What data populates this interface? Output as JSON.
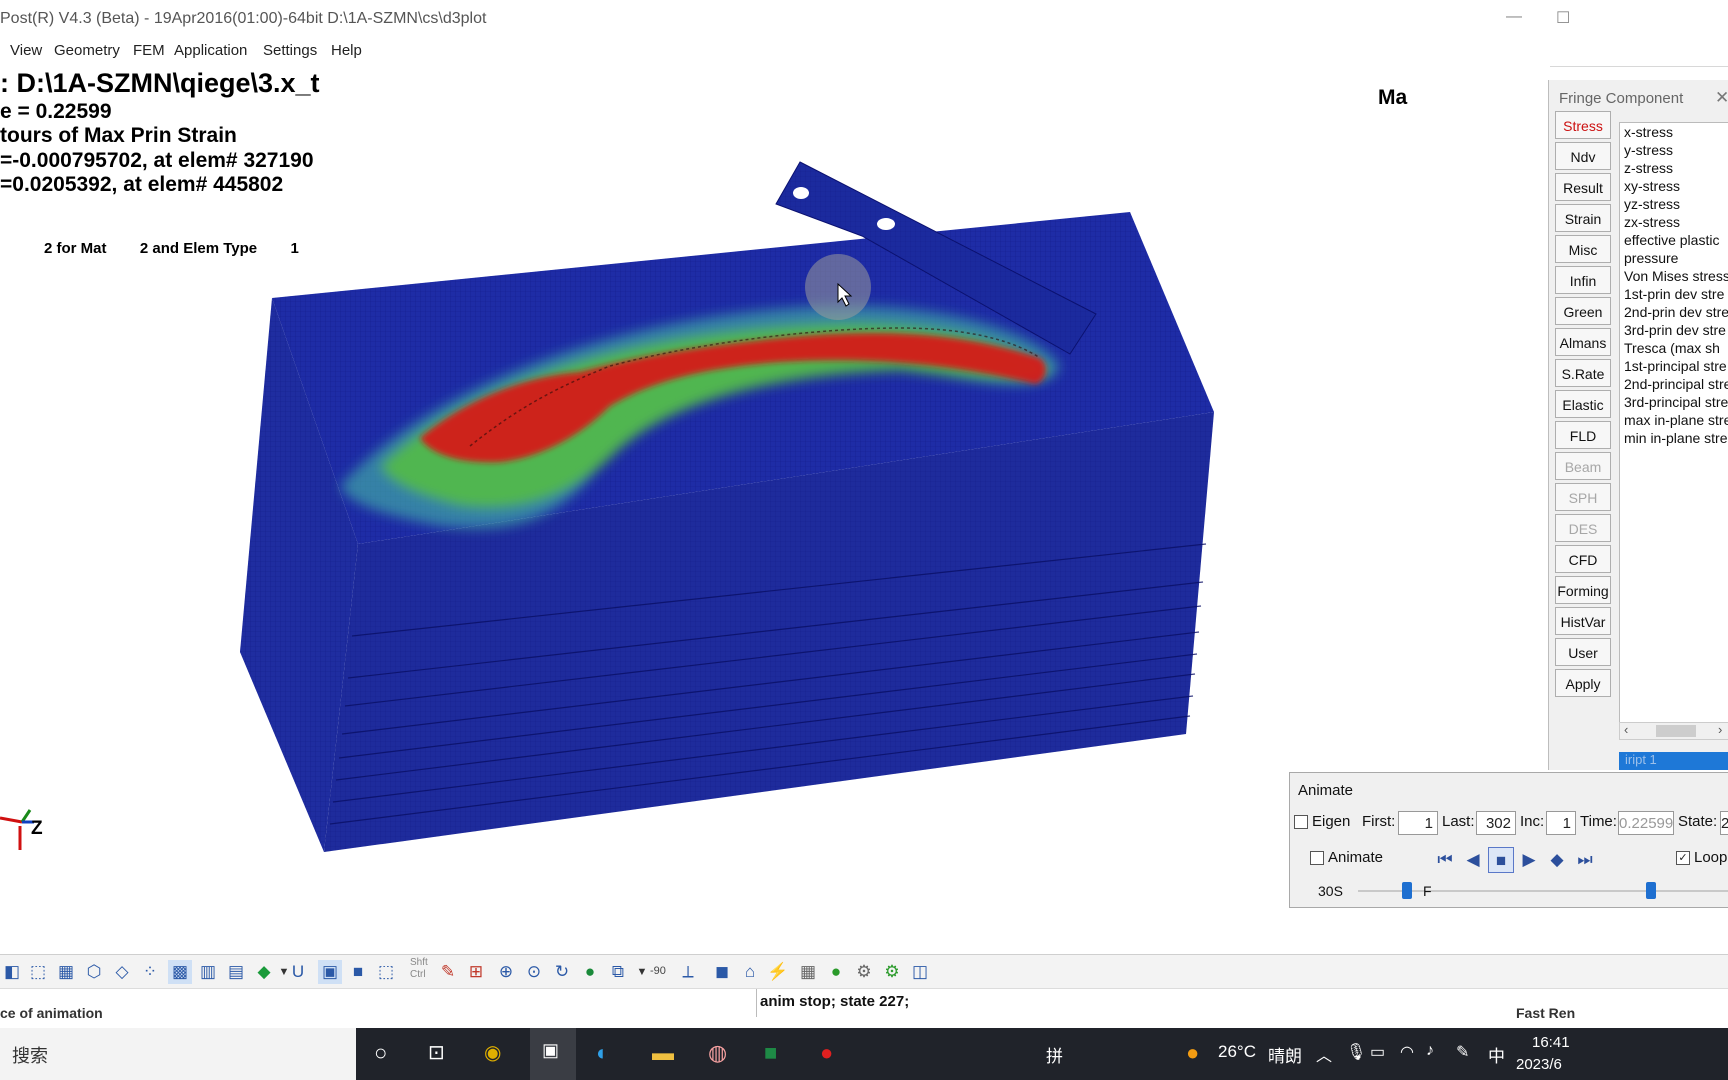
{
  "window": {
    "title": "Post(R) V4.3 (Beta) - 19Apr2016(01:00)-64bit D:\\1A-SZMN\\cs\\d3plot",
    "min_glyph": "—",
    "max_glyph": "☐"
  },
  "menu": [
    "View",
    "Geometry",
    "FEM",
    "Application",
    "Settings",
    "Help"
  ],
  "viewport_info": {
    "line1": ": D:\\1A-SZMN\\qiege\\3.x_t",
    "line2": "e =     0.22599",
    "line3": "tours of  Max Prin Strain",
    "line4": "=-0.000795702, at elem# 327190",
    "line5": "=0.0205392, at elem# 445802",
    "line6": "2 for Mat        2 and Elem Type        1",
    "partial_label": "Ma",
    "axis_label": "Z"
  },
  "fringe": {
    "header": "Fringe Component",
    "close": "✕",
    "buttons": [
      {
        "label": "Stress",
        "state": "active"
      },
      {
        "label": "Ndv",
        "state": "normal"
      },
      {
        "label": "Result",
        "state": "normal"
      },
      {
        "label": "Strain",
        "state": "normal"
      },
      {
        "label": "Misc",
        "state": "normal"
      },
      {
        "label": "Infin",
        "state": "normal"
      },
      {
        "label": "Green",
        "state": "normal"
      },
      {
        "label": "Almans",
        "state": "normal"
      },
      {
        "label": "S.Rate",
        "state": "normal"
      },
      {
        "label": "Elastic",
        "state": "normal"
      },
      {
        "label": "FLD",
        "state": "normal"
      },
      {
        "label": "Beam",
        "state": "disabled"
      },
      {
        "label": "SPH",
        "state": "disabled"
      },
      {
        "label": "DES",
        "state": "disabled"
      },
      {
        "label": "CFD",
        "state": "normal"
      },
      {
        "label": "Forming",
        "state": "normal"
      },
      {
        "label": "HistVar",
        "state": "normal"
      },
      {
        "label": "User",
        "state": "normal"
      },
      {
        "label": "Apply",
        "state": "normal"
      }
    ],
    "list": [
      "x-stress",
      "y-stress",
      "z-stress",
      "xy-stress",
      "yz-stress",
      "zx-stress",
      "effective plastic",
      "pressure",
      "Von Mises stress",
      "1st-prin dev stre",
      "2nd-prin dev stre",
      "3rd-prin dev stre",
      "Tresca (max sh",
      "1st-principal stre",
      "2nd-principal stre",
      "3rd-principal stre",
      "max in-plane stre",
      "min in-plane stre"
    ],
    "selected_text": "iript   1"
  },
  "animate": {
    "title": "Animate",
    "eigen_label": "Eigen",
    "first_label": "First:",
    "first_value": "1",
    "last_label": "Last:",
    "last_value": "302",
    "inc_label": "Inc:",
    "inc_value": "1",
    "time_label": "Time:",
    "time_value": "0.22599",
    "state_label": "State:",
    "state_value": "2",
    "animate_label": "Animate",
    "loop_label": "Loop",
    "speed_label": "30S",
    "frame_label": "F"
  },
  "toolbar": {
    "angle_label": "-90",
    "shift_label": "Shft",
    "ctrl_label": "Ctrl"
  },
  "status": {
    "left": "ce of animation",
    "message": "anim stop; state 227;",
    "right": "Fast Ren"
  },
  "taskbar": {
    "search": "搜索",
    "ime": "拼",
    "weather_temp": "26°C",
    "weather_desc": "晴朗",
    "lang": "中",
    "time": "16:41",
    "date": "2023/6"
  }
}
